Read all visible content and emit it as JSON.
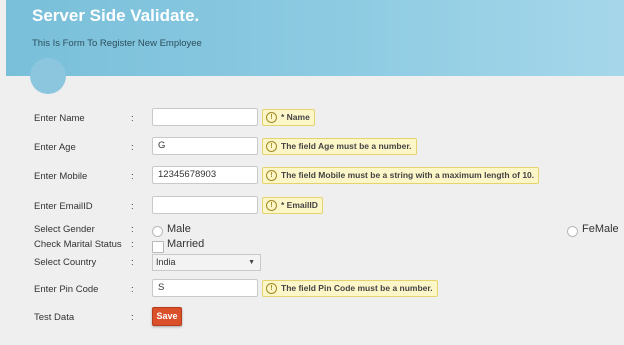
{
  "header": {
    "title": "Server Side Validate.",
    "subtitle": "This Is Form To Register New Employee"
  },
  "colon": ":",
  "form": {
    "name": {
      "label": "Enter Name",
      "value": "",
      "error": "* Name"
    },
    "age": {
      "label": "Enter Age",
      "value": "G",
      "error": "The field Age must be a number."
    },
    "mobile": {
      "label": "Enter Mobile",
      "value": "12345678903",
      "error": "The field Mobile must be a string with a maximum length of 10."
    },
    "email": {
      "label": "Enter EmailID",
      "value": "",
      "error": "* EmailID"
    },
    "gender": {
      "label": "Select Gender",
      "options": [
        "Male",
        "FeMale"
      ]
    },
    "marital": {
      "label": "Check Marital Status",
      "option": "Married"
    },
    "country": {
      "label": "Select Country",
      "selected": "India"
    },
    "pincode": {
      "label": "Enter Pin Code",
      "value": "S",
      "error": "The field Pin Code must be a number."
    },
    "test": {
      "label": "Test Data",
      "button": "Save"
    }
  },
  "icons": {
    "error": "warning-circle-icon",
    "dropdown": "chevron-down-icon"
  },
  "colors": {
    "header_gradient": [
      "#79bfd9",
      "#a6d7ea"
    ],
    "error_background": "#fdf6c8",
    "save_button": "#d9502a"
  }
}
